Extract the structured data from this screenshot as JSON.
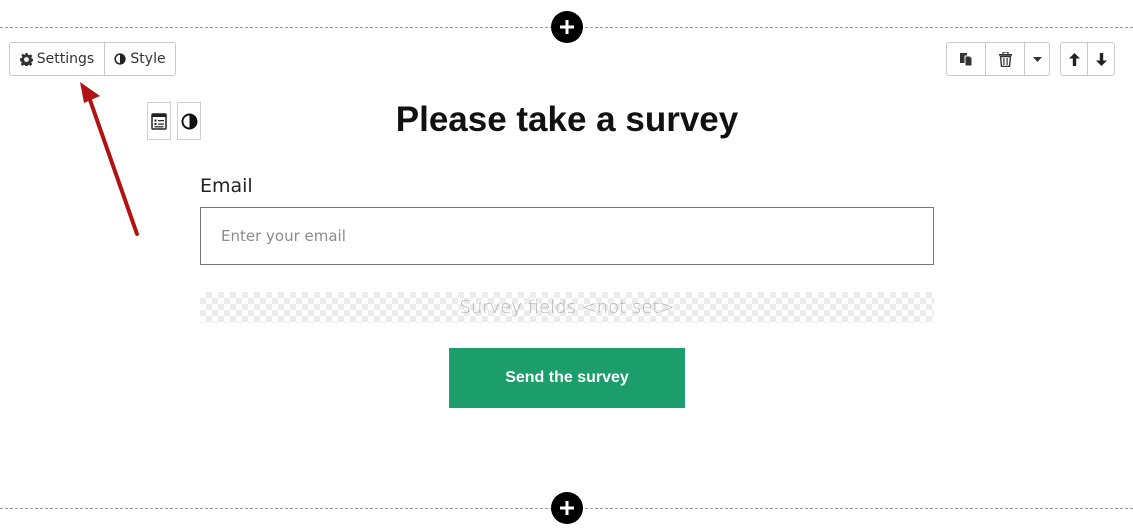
{
  "block_toolbar": {
    "settings_label": "Settings",
    "style_label": "Style"
  },
  "form": {
    "title": "Please take a survey",
    "email_label": "Email",
    "email_placeholder": "Enter your email",
    "survey_fields_placeholder": "Survey fields <not set>",
    "submit_label": "Send the survey"
  },
  "icons": {
    "top_add": "plus-icon",
    "bottom_add": "plus-icon",
    "settings": "gear-icon",
    "style": "contrast-icon",
    "copy": "copy-icon",
    "delete": "trash-icon",
    "dropdown": "caret-down-icon",
    "move_up": "arrow-up-icon",
    "move_down": "arrow-down-icon",
    "form_settings": "form-icon",
    "form_style": "contrast-icon",
    "annotation": "red-arrow"
  },
  "colors": {
    "submit_bg": "#1b9e6b",
    "annotation_arrow": "#b11212"
  }
}
